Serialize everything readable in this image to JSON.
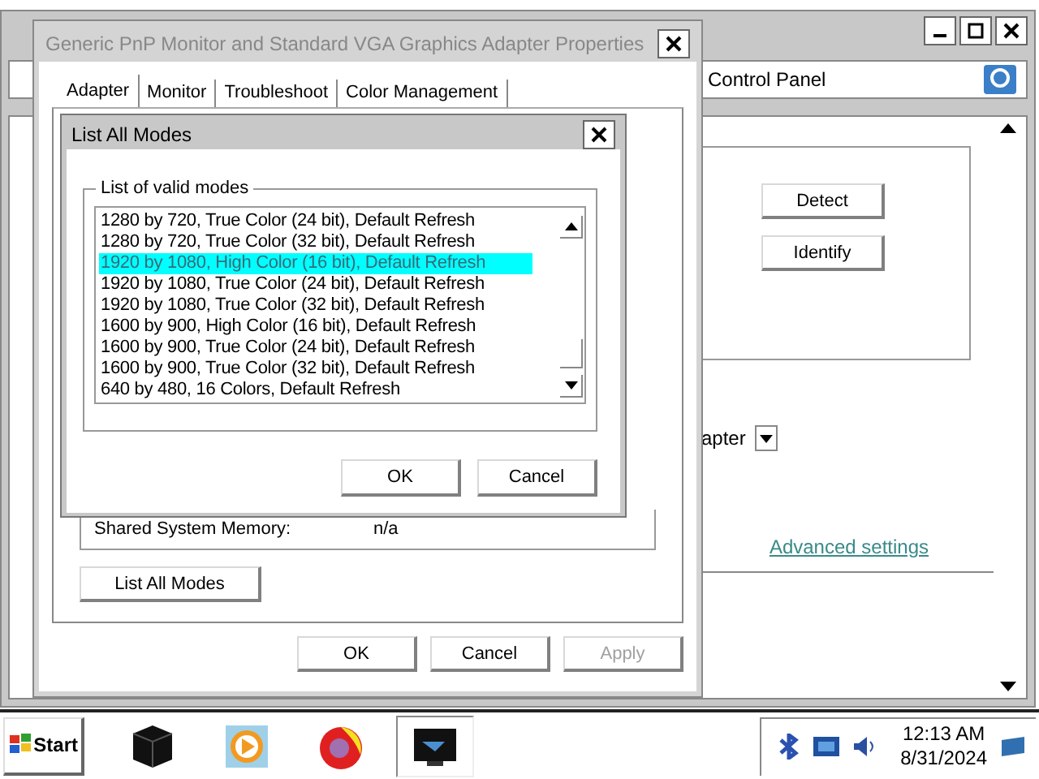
{
  "background_window": {
    "address": "Control Panel",
    "buttons": [
      "Detect",
      "Identify"
    ],
    "dropdown_value": "apter",
    "link": "Advanced settings"
  },
  "properties_dialog": {
    "title": "Generic PnP Monitor and Standard VGA Graphics Adapter Properties",
    "tabs": [
      {
        "label": "Adapter",
        "selected": true
      },
      {
        "label": "Monitor",
        "selected": false
      },
      {
        "label": "Troubleshoot",
        "selected": false
      },
      {
        "label": "Color Management",
        "selected": false
      }
    ],
    "fields": [
      {
        "label": "Shared System Memory:",
        "value": "n/a"
      }
    ],
    "list_button": "List All Modes",
    "buttons": [
      {
        "label": "OK",
        "disabled": false
      },
      {
        "label": "Cancel",
        "disabled": false
      },
      {
        "label": "Apply",
        "disabled": true
      }
    ]
  },
  "modes_dialog": {
    "title": "List All Modes",
    "group_label": "List of valid modes",
    "modes": [
      {
        "label": "1280 by 720, True Color (24 bit), Default Refresh",
        "selected": false
      },
      {
        "label": "1280 by 720, True Color (32 bit), Default Refresh",
        "selected": false
      },
      {
        "label": "1920 by 1080, High Color (16 bit), Default Refresh",
        "selected": true
      },
      {
        "label": "1920 by 1080, True Color (24 bit), Default Refresh",
        "selected": false
      },
      {
        "label": "1920 by 1080, True Color (32 bit), Default Refresh",
        "selected": false
      },
      {
        "label": "1600 by 900, High Color (16 bit), Default Refresh",
        "selected": false
      },
      {
        "label": "1600 by 900, True Color (24 bit), Default Refresh",
        "selected": false
      },
      {
        "label": "1600 by 900, True Color (32 bit), Default Refresh",
        "selected": false
      },
      {
        "label": "640 by 480, 16 Colors, Default Refresh",
        "selected": false
      }
    ],
    "buttons": [
      "OK",
      "Cancel"
    ]
  },
  "taskbar": {
    "start": "Start",
    "apps": [
      {
        "kind": "cube",
        "active": false
      },
      {
        "kind": "media",
        "active": false
      },
      {
        "kind": "browser",
        "active": false
      },
      {
        "kind": "monitor",
        "active": true
      }
    ],
    "time": "12:13 AM",
    "date": "8/31/2024"
  }
}
